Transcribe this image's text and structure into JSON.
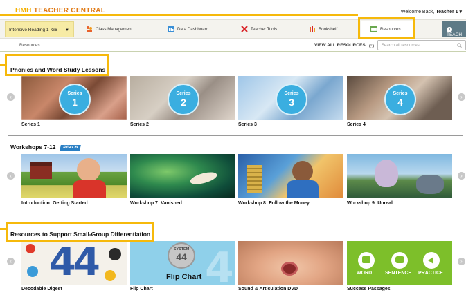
{
  "header": {
    "logo_hmh": "HMH",
    "logo_text": "TEACHER CENTRAL",
    "welcome_prefix": "Welcome Back,",
    "welcome_user": "Teacher 1 ▾"
  },
  "nav": {
    "class_select": "Intensive Reading 1_G6",
    "items": [
      {
        "label": "Class Management",
        "icon": "class-management-icon"
      },
      {
        "label": "Data Dashboard",
        "icon": "data-dashboard-icon"
      },
      {
        "label": "Teacher Tools",
        "icon": "teacher-tools-icon"
      },
      {
        "label": "Bookshelf",
        "icon": "bookshelf-icon"
      },
      {
        "label": "Resources",
        "icon": "resources-icon"
      }
    ],
    "teach_label": "TEACH",
    "teach_icon": "›"
  },
  "resources_bar": {
    "breadcrumb": "Resources",
    "view_all": "VIEW ALL RESOURCES",
    "search_placeholder": "Search all resources"
  },
  "sections": [
    {
      "title": "Phonics and Word Study Lessons",
      "cards": [
        {
          "label": "Series 1",
          "badge_word": "Series",
          "badge_num": "1"
        },
        {
          "label": "Series 2",
          "badge_word": "Series",
          "badge_num": "2"
        },
        {
          "label": "Series 3",
          "badge_word": "Series",
          "badge_num": "3"
        },
        {
          "label": "Series 4",
          "badge_word": "Series",
          "badge_num": "4"
        }
      ]
    },
    {
      "title": "Workshops 7-12",
      "badge": "REACH",
      "cards": [
        {
          "label": "Introduction: Getting Started"
        },
        {
          "label": "Workshop 7: Vanished"
        },
        {
          "label": "Workshop 8: Follow the Money"
        },
        {
          "label": "Workshop 9: Unreal"
        }
      ]
    },
    {
      "title": "Resources to Support Small-Group Differentiation",
      "cards": [
        {
          "label": "Decodable Digest",
          "art_text": "44"
        },
        {
          "label": "Flip Chart",
          "art_top": "SYSTEM",
          "art_num": "44",
          "art_bottom": "Flip Chart"
        },
        {
          "label": "Sound & Articulation DVD"
        },
        {
          "label": "Success Passages",
          "buttons": [
            "WORD",
            "SENTENCE",
            "PRACTICE"
          ]
        }
      ]
    }
  ],
  "colors": {
    "callout": "#f6b90b",
    "series_circle": "#3aaee0",
    "success_green": "#7dbf2a",
    "flip_blue": "#8fd0ea"
  }
}
